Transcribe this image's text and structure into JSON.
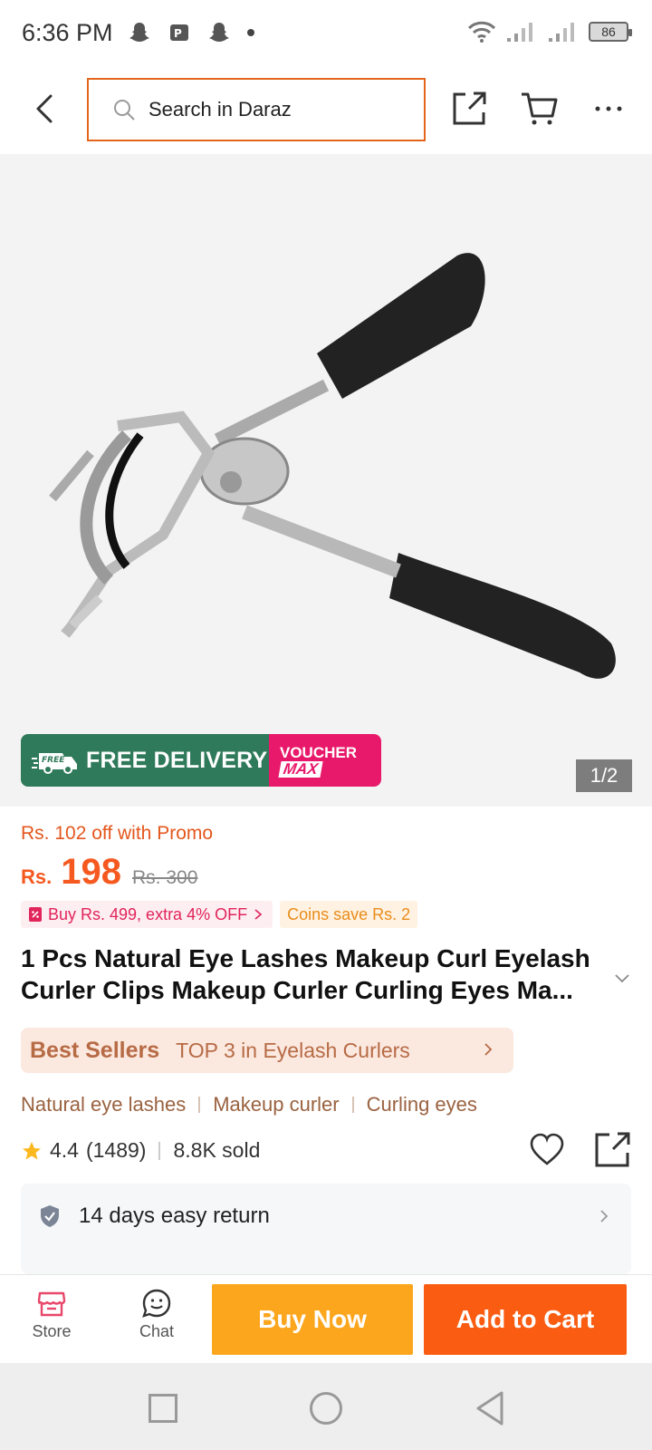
{
  "status": {
    "time": "6:36 PM",
    "battery": "86"
  },
  "header": {
    "search_placeholder": "Search in Daraz"
  },
  "gallery": {
    "page_indicator": "1/2"
  },
  "delivery_banner": {
    "free_label": "FREE",
    "delivery_text": "FREE DELIVERY",
    "voucher_top": "VOUCHER",
    "voucher_bottom": "MAX"
  },
  "price": {
    "promo": "Rs. 102 off with Promo",
    "currency": "Rs.",
    "current": "198",
    "original": "Rs. 300",
    "voucher_tag": "Buy Rs. 499, extra 4% OFF",
    "coins_tag": "Coins save Rs. 2"
  },
  "product": {
    "title": "1 Pcs Natural Eye Lashes Makeup Curl Eyelash Curler Clips Makeup Curler Curling Eyes Ma..."
  },
  "bestseller": {
    "label": "Best Sellers",
    "rank": "TOP 3 in Eyelash Curlers"
  },
  "keywords": [
    "Natural eye lashes",
    "Makeup curler",
    "Curling eyes"
  ],
  "rating": {
    "score": "4.4",
    "count": "(1489)",
    "sold": "8.8K sold"
  },
  "returns": {
    "text": "14 days easy return"
  },
  "actions": {
    "store": "Store",
    "chat": "Chat",
    "buy_now": "Buy Now",
    "add_to_cart": "Add to Cart"
  },
  "colors": {
    "brand_orange": "#fa5c12",
    "buy_now": "#fca61d",
    "search_border": "#e4661c",
    "delivery_green": "#2f7a5a",
    "voucher_pink": "#e8196a"
  }
}
